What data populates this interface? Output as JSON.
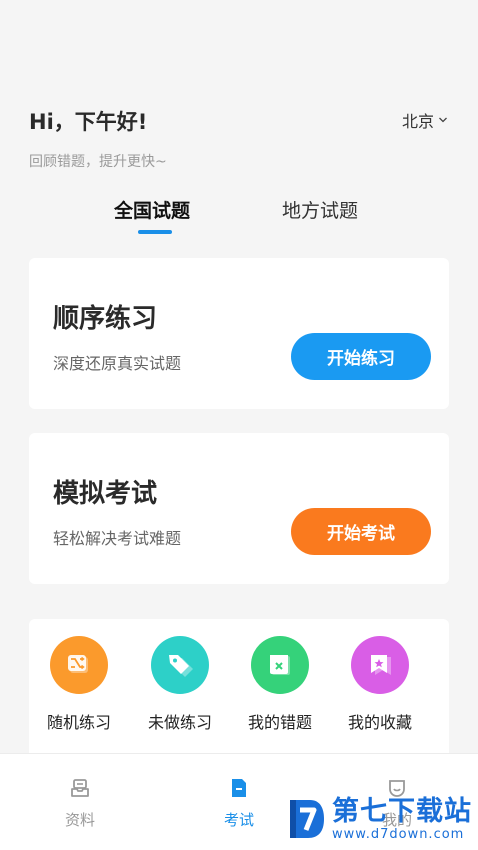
{
  "header": {
    "greeting": "Hi，下午好!",
    "subtitle": "回顾错题，提升更快~",
    "city": "北京"
  },
  "tabs": [
    {
      "label": "全国试题",
      "active": true
    },
    {
      "label": "地方试题",
      "active": false
    }
  ],
  "cards": [
    {
      "title": "顺序练习",
      "desc": "深度还原真实试题",
      "button": "开始练习",
      "color": "#1a9af2"
    },
    {
      "title": "模拟考试",
      "desc": "轻松解决考试难题",
      "button": "开始考试",
      "color": "#fa7a1e"
    }
  ],
  "tools": [
    {
      "label": "随机练习",
      "icon": "shuffle-icon",
      "color": "#fb9a2c"
    },
    {
      "label": "未做练习",
      "icon": "tag-icon",
      "color": "#2dd0c8"
    },
    {
      "label": "我的错题",
      "icon": "wrong-list-icon",
      "color": "#35d27a"
    },
    {
      "label": "我的收藏",
      "icon": "star-bookmark-icon",
      "color": "#d95ee6"
    }
  ],
  "nav": [
    {
      "label": "资料",
      "icon": "inbox-icon",
      "active": false
    },
    {
      "label": "考试",
      "icon": "document-icon",
      "active": true
    },
    {
      "label": "我的",
      "icon": "profile-icon",
      "active": false
    }
  ],
  "watermark": {
    "name": "第七下载站",
    "url": "www.d7down.com"
  },
  "colors": {
    "accent": "#1a8fe8",
    "orange": "#fa7a1e",
    "background": "#f5f5f5"
  }
}
